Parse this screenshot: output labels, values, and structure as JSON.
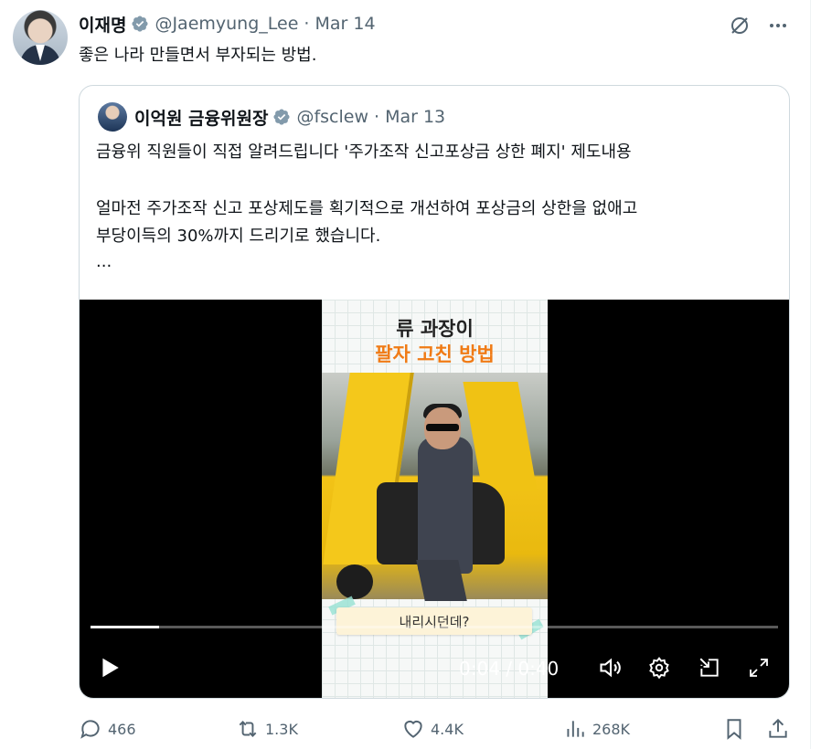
{
  "tweet": {
    "author_name": "이재명",
    "handle": "@Jaemyung_Lee",
    "separator": "·",
    "date": "Mar 14",
    "text": "좋은 나라 만들면서 부자되는 방법.",
    "icons": {
      "verified": "verified-badge-icon",
      "grok": "grok-icon",
      "more": "more-icon"
    }
  },
  "quote": {
    "author_name": "이억원 금융위원장",
    "handle": "@fsclew",
    "separator": "·",
    "date": "Mar 13",
    "lines": [
      "금융위 직원들이 직접 알려드립니다 '주가조작 신고포상금 상한 폐지' 제도내용",
      "얼마전 주가조작 신고 포상제도를 획기적으로 개선하여 포상금의 상한을 없애고",
      "부당이득의 30%까지 드리기로 했습니다.",
      "..."
    ],
    "video": {
      "title_line1": "류 과장이",
      "title_line2": "팔자 고친 방법",
      "subtitle": "내리시던데?",
      "time": "0:04 / 0:40",
      "progress": 0.1,
      "accent_color": "#f07b16",
      "controls": [
        "play-icon",
        "volume-icon",
        "settings-icon",
        "pip-icon",
        "fullscreen-icon"
      ]
    }
  },
  "actions": {
    "replies": "466",
    "reposts": "1.3K",
    "likes": "4.4K",
    "views": "268K"
  }
}
